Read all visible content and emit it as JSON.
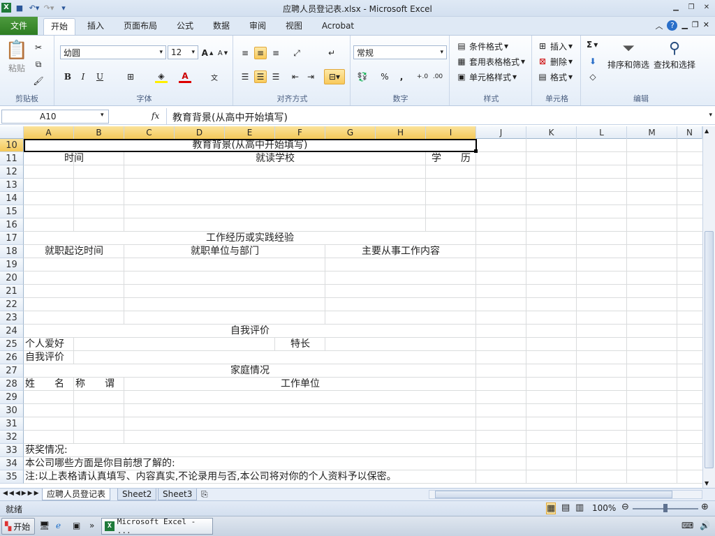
{
  "window": {
    "title": "应聘人员登记表.xlsx - Microsoft Excel"
  },
  "tabs": [
    {
      "label": "文件"
    },
    {
      "label": "开始"
    },
    {
      "label": "插入"
    },
    {
      "label": "页面布局"
    },
    {
      "label": "公式"
    },
    {
      "label": "数据"
    },
    {
      "label": "审阅"
    },
    {
      "label": "视图"
    },
    {
      "label": "Acrobat"
    }
  ],
  "ribbon": {
    "clipboard": {
      "label": "剪贴板",
      "paste": "粘贴"
    },
    "font": {
      "label": "字体",
      "family": "幼圆",
      "size": "12",
      "bold": "B",
      "italic": "I",
      "underline": "U"
    },
    "align": {
      "label": "对齐方式"
    },
    "number": {
      "label": "数字",
      "format": "常规",
      "percent": "%",
      "comma": ","
    },
    "styles": {
      "label": "样式",
      "conditional": "条件格式",
      "table": "套用表格格式",
      "cell": "单元格样式"
    },
    "cells": {
      "label": "单元格",
      "insert": "插入",
      "delete": "删除",
      "format": "格式"
    },
    "edit": {
      "label": "编辑",
      "sum": "Σ",
      "sort": "排序和筛选",
      "find": "查找和选择"
    }
  },
  "formula": {
    "cell_ref": "A10",
    "fx": "fx",
    "content": "教育背景(从高中开始填写)"
  },
  "columns": [
    "A",
    "B",
    "C",
    "D",
    "E",
    "F",
    "G",
    "H",
    "I",
    "J",
    "K",
    "L",
    "M",
    "N"
  ],
  "rows": [
    "10",
    "11",
    "12",
    "13",
    "14",
    "15",
    "16",
    "17",
    "18",
    "19",
    "20",
    "21",
    "22",
    "23",
    "24",
    "25",
    "26",
    "27",
    "28",
    "29",
    "30",
    "31",
    "32",
    "33",
    "34",
    "35"
  ],
  "cells": {
    "r10": "教育背景(从高中开始填写)",
    "r11a": "时间",
    "r11b": "就读学校",
    "r11c": "学　　历",
    "r17": "工作经历或实践经验",
    "r18a": "就职起讫时间",
    "r18b": "就职单位与部门",
    "r18c": "主要从事工作内容",
    "r24": "自我评价",
    "r25a": "个人爱好",
    "r25b": "特长",
    "r26": "自我评价",
    "r27": "家庭情况",
    "r28a": "姓　　名",
    "r28b": "称　　谓",
    "r28c": "工作单位",
    "r33": "获奖情况:",
    "r34": "本公司哪些方面是你目前想了解的:",
    "r35": "注:以上表格请认真填写、内容真实,不论录用与否,本公司将对你的个人资料予以保密。"
  },
  "sheets": [
    {
      "label": "应聘人员登记表"
    },
    {
      "label": "Sheet2"
    },
    {
      "label": "Sheet3"
    }
  ],
  "status": {
    "ready": "就绪",
    "zoom": "100%"
  },
  "taskbar": {
    "start": "开始",
    "app": "Microsoft Excel - ..."
  }
}
